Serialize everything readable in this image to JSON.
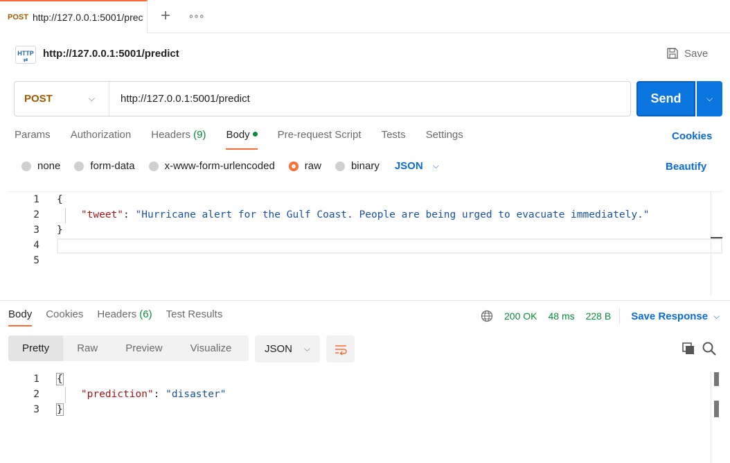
{
  "tab": {
    "method": "POST",
    "title": "http://127.0.0.1:5001/prec"
  },
  "header": {
    "icon_label": "HTTP",
    "title": "http://127.0.0.1:5001/predict",
    "save_label": "Save"
  },
  "request": {
    "method": "POST",
    "url": "http://127.0.0.1:5001/predict",
    "send_label": "Send"
  },
  "request_tabs": {
    "params": "Params",
    "authorization": "Authorization",
    "headers": "Headers",
    "headers_count": "(9)",
    "body": "Body",
    "prerequest": "Pre-request Script",
    "tests": "Tests",
    "settings": "Settings",
    "cookies": "Cookies"
  },
  "body_types": {
    "none": "none",
    "form_data": "form-data",
    "urlencoded": "x-www-form-urlencoded",
    "raw": "raw",
    "binary": "binary",
    "format": "JSON",
    "beautify": "Beautify"
  },
  "request_body": {
    "line_numbers": [
      "1",
      "2",
      "3",
      "4",
      "5"
    ],
    "open_brace": "{",
    "key": "\"tweet\"",
    "colon": ": ",
    "value": "\"Hurricane alert for the Gulf Coast. People are being urged to evacuate immediately.\"",
    "close_brace": "}"
  },
  "response_tabs": {
    "body": "Body",
    "cookies": "Cookies",
    "headers": "Headers",
    "headers_count": "(6)",
    "test_results": "Test Results"
  },
  "response_status": {
    "status": "200 OK",
    "time": "48 ms",
    "size": "228 B",
    "save_response": "Save Response"
  },
  "response_view": {
    "pretty": "Pretty",
    "raw": "Raw",
    "preview": "Preview",
    "visualize": "Visualize",
    "format": "JSON"
  },
  "response_body": {
    "line_numbers": [
      "1",
      "2",
      "3"
    ],
    "open_brace": "{",
    "key": "\"prediction\"",
    "colon": ": ",
    "value": "\"disaster\"",
    "close_brace": "}"
  },
  "colors": {
    "accent": "#ff6c37",
    "send": "#0b75e0",
    "link": "#0b6ad8",
    "success": "#0a8a3a",
    "method": "#a05a00"
  }
}
